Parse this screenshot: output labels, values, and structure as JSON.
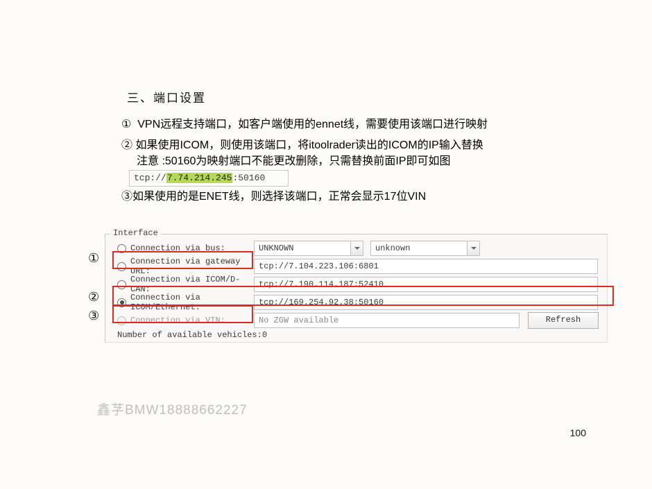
{
  "section_title": "三、端口设置",
  "bullets": {
    "line1": "①  VPN远程支持端口，如客户端使用的ennet线，需要使用该端口进行映射",
    "line2": "② 如果使用ICOM，则使用该端口，将itoolrader读出的ICOM的IP输入替换",
    "line2b": "注意 :50160为映射端口不能更改删除，只需替换前面IP即可如图",
    "line3": "③如果使用的是ENET线，则选择该端口，正常会显示17位VIN"
  },
  "tcp_example": {
    "prefix": "tcp://",
    "highlight": "7.74.214.245",
    "suffix": ":50160"
  },
  "interface": {
    "legend": "Interface",
    "rows": {
      "bus": {
        "label": "Connection via bus:",
        "combo1": "UNKNOWN",
        "combo2": "unknown"
      },
      "gateway": {
        "label": "Connection via gateway URL:",
        "value": "tcp://7.104.223.106:6801"
      },
      "icom_dcan": {
        "label": "Connection via ICOM/D-CAN:",
        "value": "tcp://7.190.114.187:52410"
      },
      "icom_eth": {
        "label": "Connection via ICOM/Ethernet:",
        "value": "tcp://169.254.92.38:50160"
      },
      "vin": {
        "label": "Connection via VIN:",
        "value": "No ZGW available"
      }
    },
    "vehicles": "Number of available vehicles:0",
    "refresh": "Refresh"
  },
  "margin": {
    "c1": "①",
    "c2": "②",
    "c3": "③"
  },
  "watermark": "鑫芓BMW18888662227",
  "pagenum": "100"
}
